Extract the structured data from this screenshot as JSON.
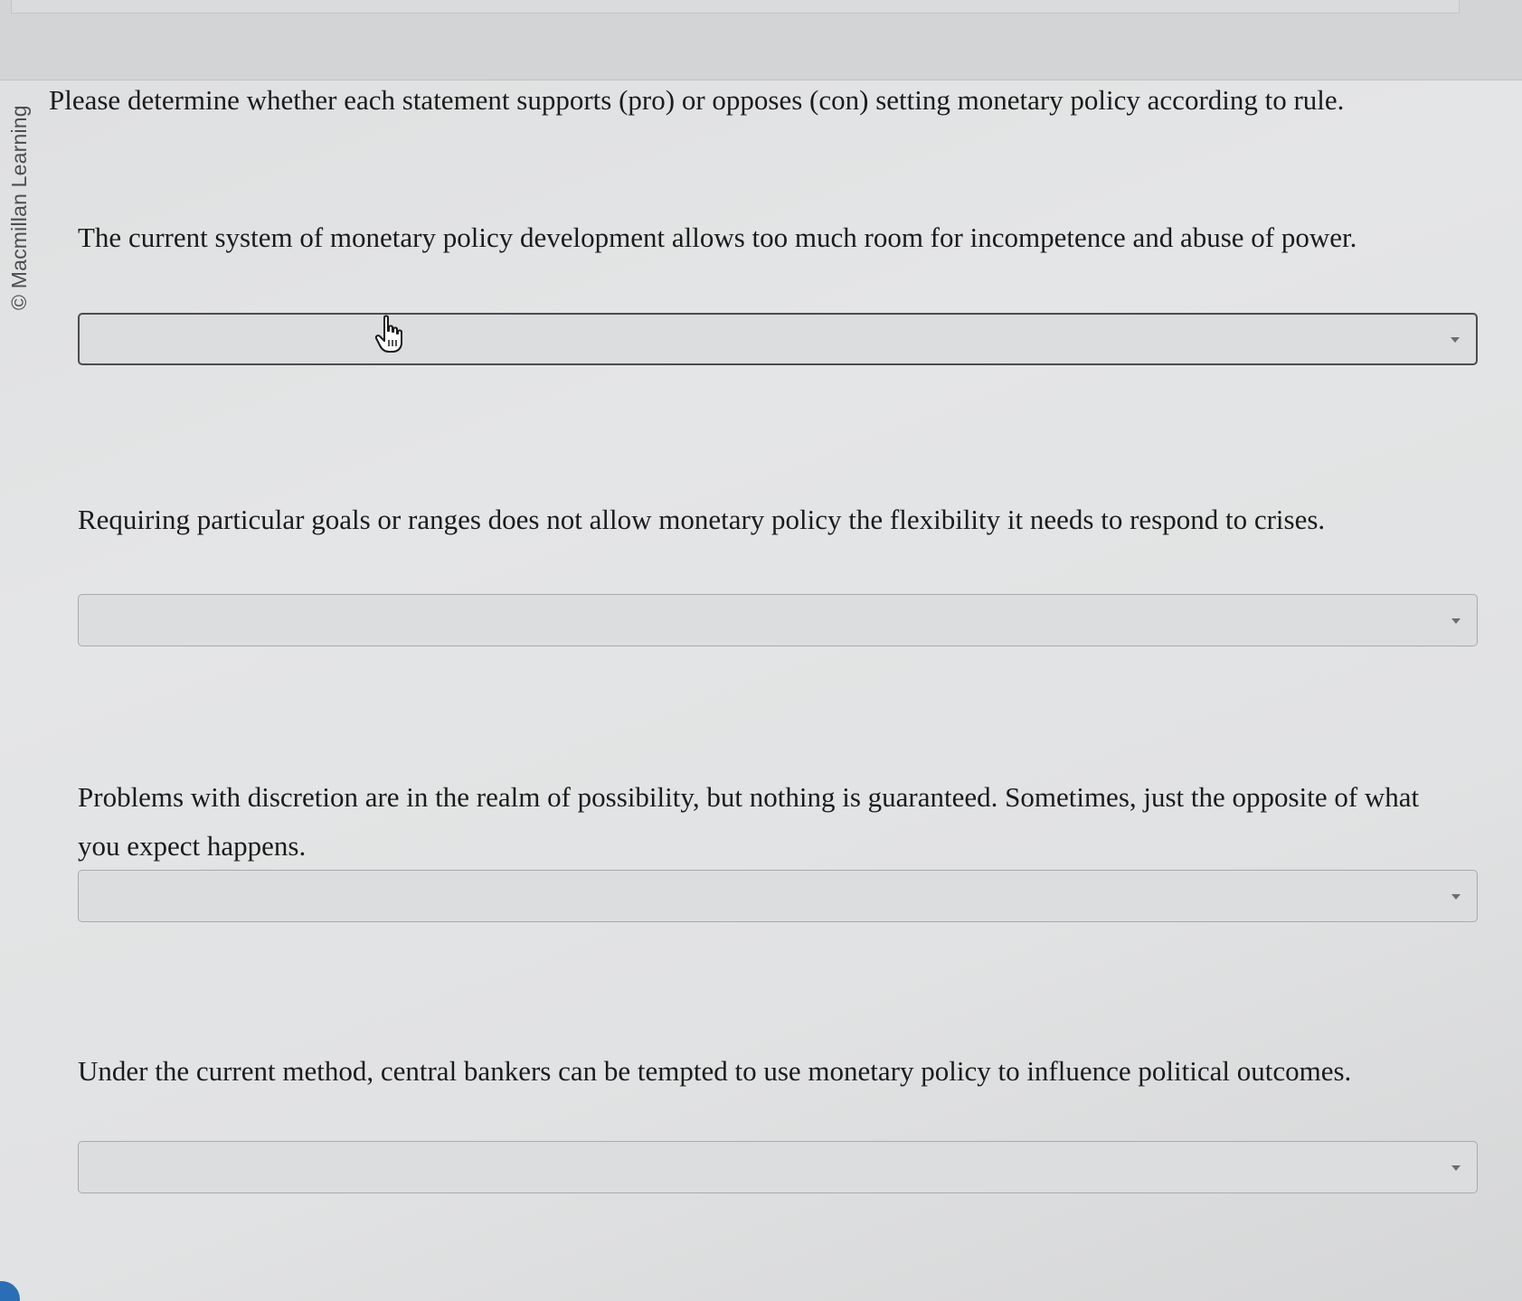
{
  "watermark": "© Macmillan Learning",
  "instruction": "Please determine whether each statement supports (pro) or opposes (con) setting monetary policy according to rule.",
  "statements": [
    {
      "text": "The current system of monetary policy development allows too much room for incompetence and abuse of power.",
      "selected_value": ""
    },
    {
      "text": "Requiring particular goals or ranges does not allow monetary policy the flexibility it needs to respond to crises.",
      "selected_value": ""
    },
    {
      "text": "Problems with discretion are in the realm of possibility, but nothing is guaranteed. Sometimes, just the opposite of what you expect happens.",
      "selected_value": ""
    },
    {
      "text": "Under the current method, central bankers can be tempted to use monetary policy to influence political outcomes.",
      "selected_value": ""
    }
  ],
  "icons": {
    "dropdown_arrow": "chevron-down-icon",
    "pointer": "hand-pointer-icon"
  },
  "colors": {
    "background": "#e1e2e3",
    "dropdown_fill": "#dcdddf",
    "dropdown_border": "#a9aaad",
    "text": "#1b1b1c"
  }
}
